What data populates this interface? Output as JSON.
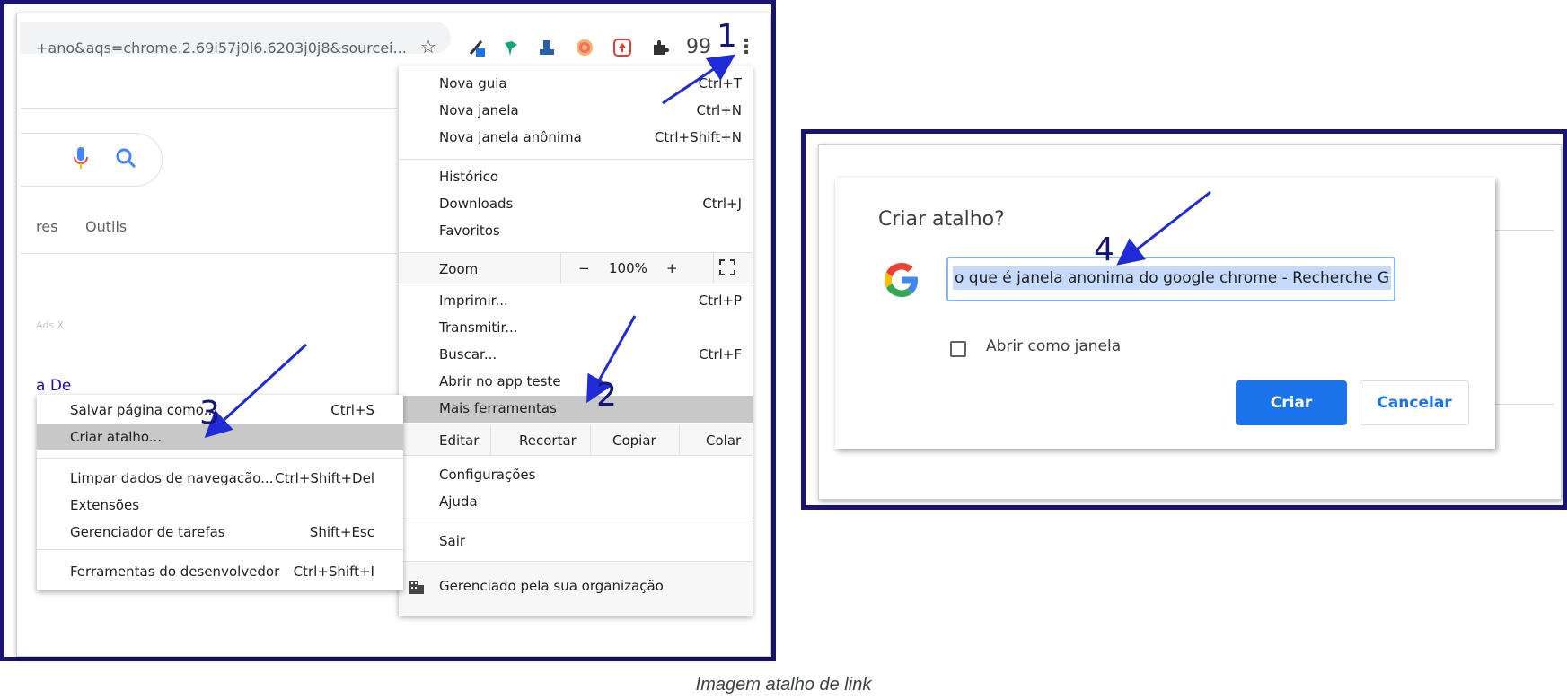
{
  "browser": {
    "url_fragment": "+ano&aqs=chrome.2.69i57j0l6.6203j0j8&sourcei...",
    "tabs_partial": [
      "res",
      "Outils"
    ],
    "ads_fragment": "Ads X",
    "result_fragment": "a De",
    "extension_icons": [
      "eyedropper-icon",
      "bird-icon",
      "stamp-icon",
      "target-icon",
      "upload-icon",
      "puzzle-icon",
      "quote-icon"
    ],
    "menu_button_icon": "three-dots-icon"
  },
  "chrome_menu": {
    "items": [
      {
        "label": "Nova guia",
        "shortcut": "Ctrl+T"
      },
      {
        "label": "Nova janela",
        "shortcut": "Ctrl+N"
      },
      {
        "label": "Nova janela anônima",
        "shortcut": "Ctrl+Shift+N"
      },
      {
        "label": "Histórico",
        "shortcut": ""
      },
      {
        "label": "Downloads",
        "shortcut": "Ctrl+J"
      },
      {
        "label": "Favoritos",
        "shortcut": ""
      },
      {
        "label": "Imprimir...",
        "shortcut": "Ctrl+P"
      },
      {
        "label": "Transmitir...",
        "shortcut": ""
      },
      {
        "label": "Buscar...",
        "shortcut": "Ctrl+F"
      },
      {
        "label": "Abrir no app teste",
        "shortcut": ""
      },
      {
        "label": "Mais ferramentas",
        "shortcut": ""
      },
      {
        "label": "Configurações",
        "shortcut": ""
      },
      {
        "label": "Ajuda",
        "shortcut": ""
      },
      {
        "label": "Sair",
        "shortcut": ""
      },
      {
        "label": "Gerenciado pela sua organização",
        "shortcut": ""
      }
    ],
    "zoom": {
      "label": "Zoom",
      "minus": "−",
      "value": "100%",
      "plus": "+"
    },
    "edit": {
      "label": "Editar",
      "cut": "Recortar",
      "copy": "Copiar",
      "paste": "Colar"
    }
  },
  "submenu": {
    "items": [
      {
        "label": "Salvar página como...",
        "shortcut": "Ctrl+S"
      },
      {
        "label": "Criar atalho...",
        "shortcut": ""
      },
      {
        "label": "Limpar dados de navegação...",
        "shortcut": "Ctrl+Shift+Del"
      },
      {
        "label": "Extensões",
        "shortcut": ""
      },
      {
        "label": "Gerenciador de tarefas",
        "shortcut": "Shift+Esc"
      },
      {
        "label": "Ferramentas do desenvolvedor",
        "shortcut": "Ctrl+Shift+I"
      }
    ]
  },
  "dialog": {
    "title": "Criar atalho?",
    "name_value": "o que é janela anonima do google chrome - Recherche G",
    "checkbox_label": "Abrir como janela",
    "create_label": "Criar",
    "cancel_label": "Cancelar"
  },
  "annotations": {
    "step1": "1",
    "step2": "2",
    "step3": "3",
    "step4": "4",
    "arrow_color": "#1f2bd6"
  },
  "caption": "Imagem atalho de link",
  "colors": {
    "frame": "#1a1472",
    "highlight": "#c8c8c8",
    "primary_button": "#1a73e8",
    "selection": "#c6dafc"
  }
}
